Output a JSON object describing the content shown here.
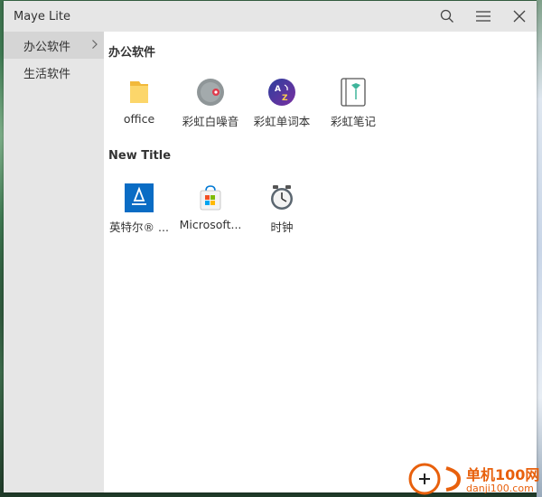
{
  "window": {
    "title": "Maye Lite",
    "controls": {
      "search": "search-icon",
      "menu": "menu-icon",
      "close": "close-icon"
    }
  },
  "sidebar": {
    "items": [
      {
        "label": "办公软件",
        "active": true
      },
      {
        "label": "生活软件",
        "active": false
      }
    ]
  },
  "groups": [
    {
      "title": "办公软件",
      "apps": [
        {
          "label": "office",
          "icon": "folder-icon"
        },
        {
          "label": "彩虹白噪音",
          "icon": "white-noise-icon"
        },
        {
          "label": "彩虹单词本",
          "icon": "wordbook-icon"
        },
        {
          "label": "彩虹笔记",
          "icon": "notebook-icon"
        }
      ]
    },
    {
      "title": "New Title",
      "apps": [
        {
          "label": "英特尔® ...",
          "icon": "intel-icon"
        },
        {
          "label": "Microsoft...",
          "icon": "microsoft-store-icon"
        },
        {
          "label": "时钟",
          "icon": "clock-icon"
        }
      ]
    }
  ],
  "watermark": {
    "brand": "单机100网",
    "url": "danji100.com"
  },
  "colors": {
    "sidebar_bg": "#e6e6e6",
    "active_item_bg": "#d5d5d5",
    "watermark_orange": "#e8600c"
  }
}
